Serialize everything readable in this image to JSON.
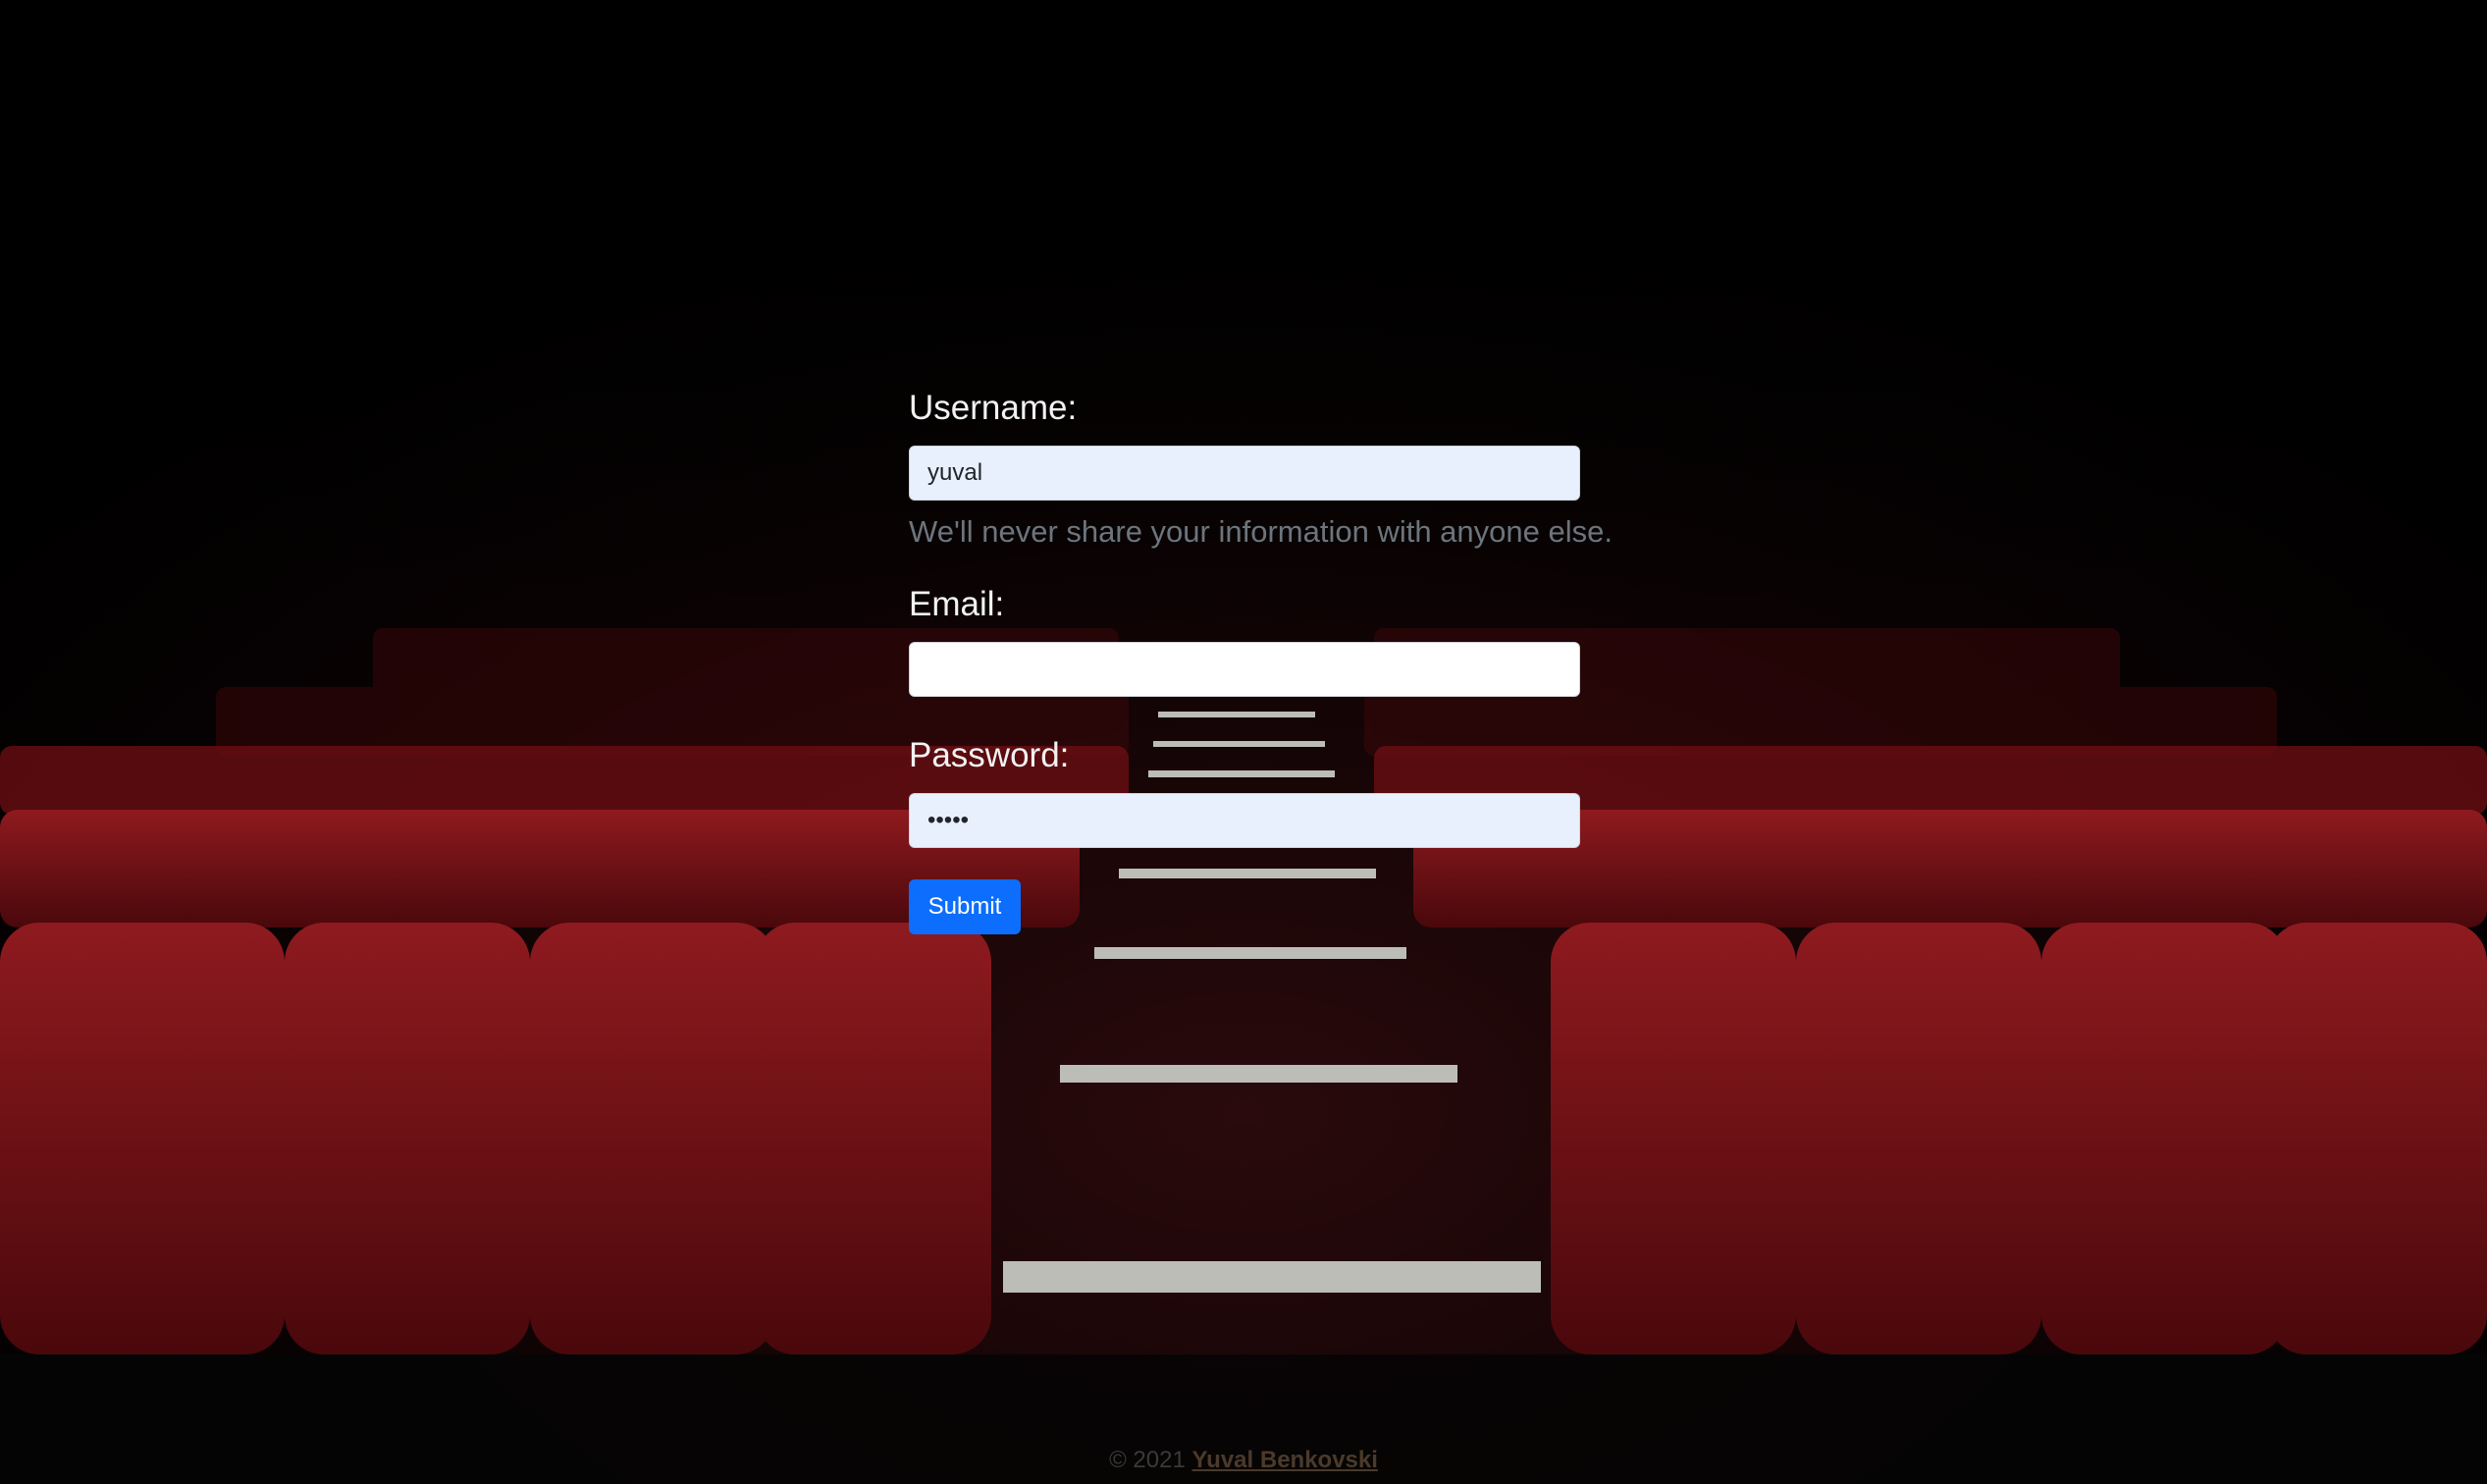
{
  "form": {
    "username_label": "Username:",
    "username_value": "yuval",
    "help_text": "We'll never share your information with anyone else.",
    "email_label": "Email:",
    "email_value": "",
    "password_label": "Password:",
    "password_value": "•••••",
    "submit_label": "Submit"
  },
  "footer": {
    "copyright": "© 2021",
    "author": "Yuval Benkovski"
  },
  "colors": {
    "seat_red": "#7a0f14",
    "button_blue": "#0d6efd",
    "autofill_bg": "#e8f0fe"
  }
}
